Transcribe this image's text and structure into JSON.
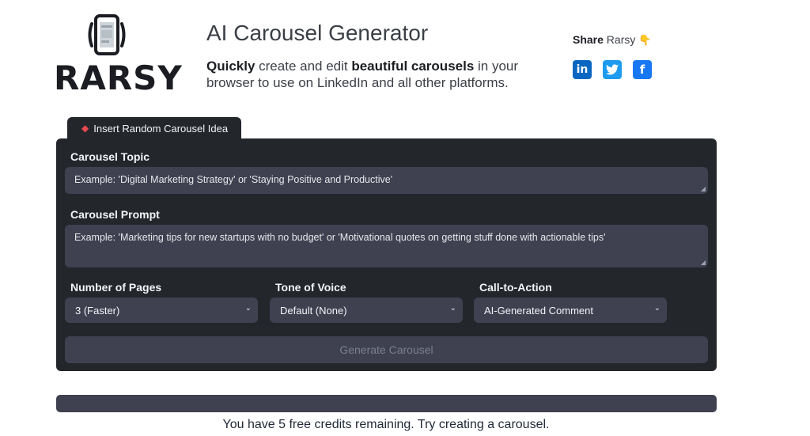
{
  "brand": {
    "name": "RARSY"
  },
  "header": {
    "title": "AI Carousel Generator",
    "subtitle_bold1": "Quickly",
    "subtitle_t1": " create and edit ",
    "subtitle_bold2": "beautiful carousels",
    "subtitle_t2": " in your browser to use on LinkedIn and all other platforms."
  },
  "share": {
    "label_bold": "Share",
    "label_rest": " Rarsy",
    "hand_icon": "👇",
    "socials": [
      {
        "name": "linkedin-icon",
        "glyph": "in"
      },
      {
        "name": "twitter-icon",
        "glyph": "🐦"
      },
      {
        "name": "facebook-icon",
        "glyph": "f"
      }
    ]
  },
  "tab": {
    "icon": "ruby-gem-icon",
    "label": "Insert Random Carousel Idea"
  },
  "form": {
    "topic_label": "Carousel Topic",
    "topic_placeholder": "Example: 'Digital Marketing Strategy' or 'Staying Positive and Productive'",
    "prompt_label": "Carousel Prompt",
    "prompt_placeholder": "Example: 'Marketing tips for new startups with no budget' or 'Motivational quotes on getting stuff done with actionable tips'",
    "pages_label": "Number of Pages",
    "pages_value": "3 (Faster)",
    "tone_label": "Tone of Voice",
    "tone_value": "Default (None)",
    "cta_label": "Call-to-Action",
    "cta_value": "AI-Generated Comment",
    "generate_label": "Generate Carousel"
  },
  "credits_text": "You have 5 free credits remaining. Try creating a carousel.",
  "colors": {
    "panel": "#23262b",
    "field": "#3f4150",
    "accent_red": "#e5484d"
  }
}
